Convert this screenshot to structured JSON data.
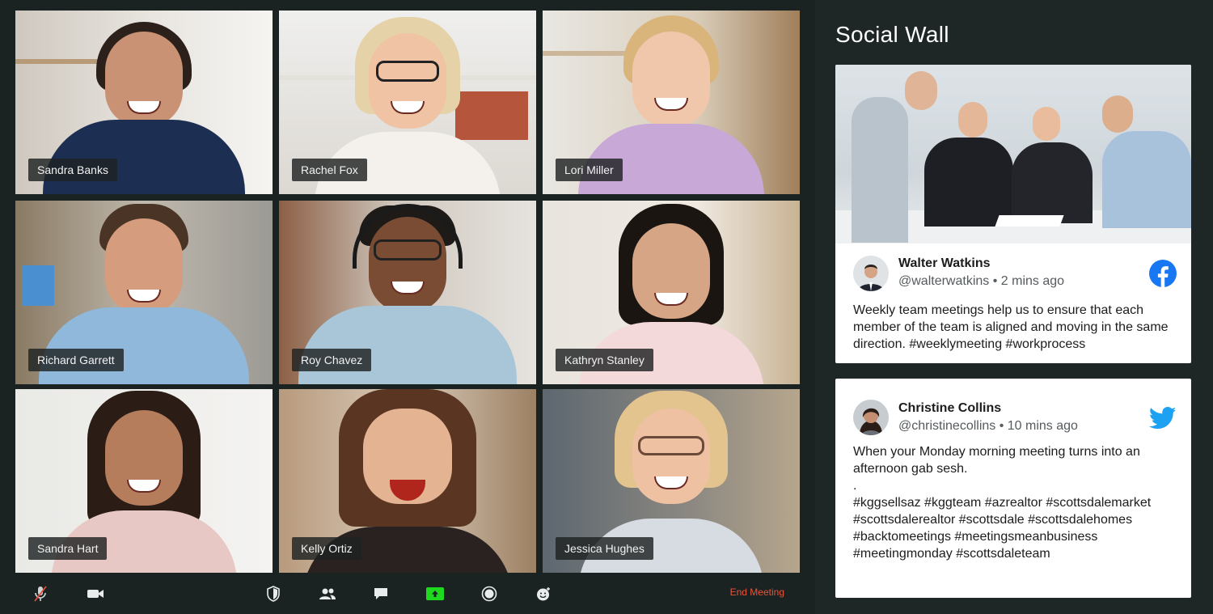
{
  "participants": [
    {
      "name": "Sandra Banks"
    },
    {
      "name": "Rachel Fox"
    },
    {
      "name": "Lori Miller"
    },
    {
      "name": "Richard Garrett"
    },
    {
      "name": "Roy Chavez"
    },
    {
      "name": "Kathryn Stanley"
    },
    {
      "name": "Sandra Hart"
    },
    {
      "name": "Kelly Ortiz"
    },
    {
      "name": "Jessica Hughes"
    }
  ],
  "toolbar": {
    "buttons": [
      {
        "icon": "microphone-muted-icon"
      },
      {
        "icon": "video-camera-icon"
      },
      {
        "icon": "security-shield-icon"
      },
      {
        "icon": "participants-icon"
      },
      {
        "icon": "chat-icon"
      },
      {
        "icon": "share-screen-icon"
      },
      {
        "icon": "record-icon"
      },
      {
        "icon": "reactions-icon"
      }
    ],
    "end_label": "End Meeting",
    "end_color": "#e8553a",
    "share_color": "#1fd91f"
  },
  "wall": {
    "title": "Social Wall",
    "posts": [
      {
        "author": "Walter Watkins",
        "handle": "@walterwatkins",
        "time": "2 mins ago",
        "network_icon": "facebook-icon",
        "network_color": "#1877f2",
        "text": "Weekly team meetings help us to ensure that each member of the team is aligned and moving in the same direction. #weeklymeeting #workprocess"
      },
      {
        "author": "Christine Collins",
        "handle": "@christinecollins",
        "time": "10 mins ago",
        "network_icon": "twitter-icon",
        "network_color": "#1da1f2",
        "text": "When your Monday morning meeting turns into an afternoon gab sesh.\n.\n#kggsellsaz #kggteam #azrealtor #scottsdalemarket #scottsdalerealtor #scottsdale #scottsdalehomes #backtomeetings #meetingsmeanbusiness #meetingmonday #scottsdaleteam"
      }
    ]
  }
}
